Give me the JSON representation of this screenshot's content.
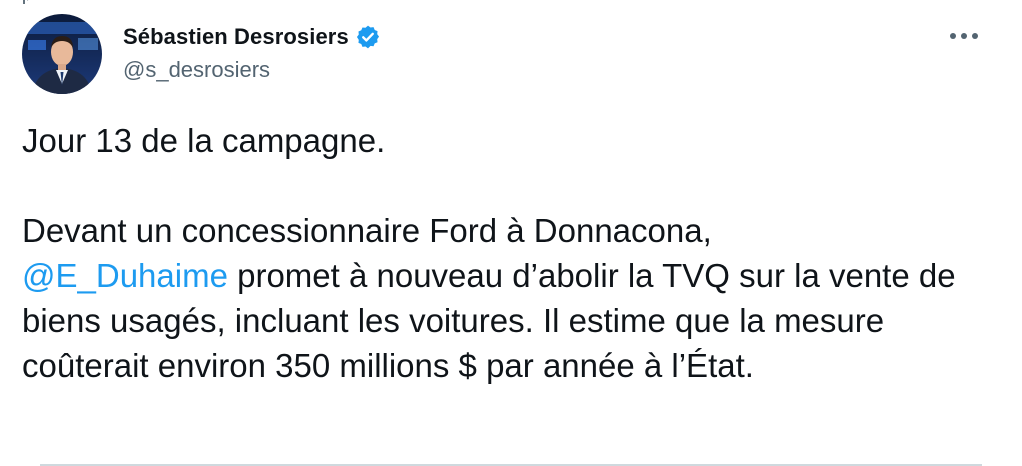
{
  "author": {
    "display_name": "Sébastien Desrosiers",
    "handle": "@s_desrosiers",
    "verified": true
  },
  "more_icon": "more-horizontal-icon",
  "tweet": {
    "line_1": "Jour 13 de la campagne.",
    "para_2_lead": "Devant un concessionnaire Ford à Donnacona,",
    "mention": "@E_Duhaime",
    "para_2_rest": " promet à nouveau d’abolir la TVQ sur la vente de biens usagés, incluant les voitures. Il estime que la mesure coûterait environ 350 millions $ par année à l’État."
  },
  "colors": {
    "text": "#0f1419",
    "secondary": "#536471",
    "link": "#1d9bf0",
    "verified": "#1d9bf0",
    "divider": "#cfd9de"
  }
}
